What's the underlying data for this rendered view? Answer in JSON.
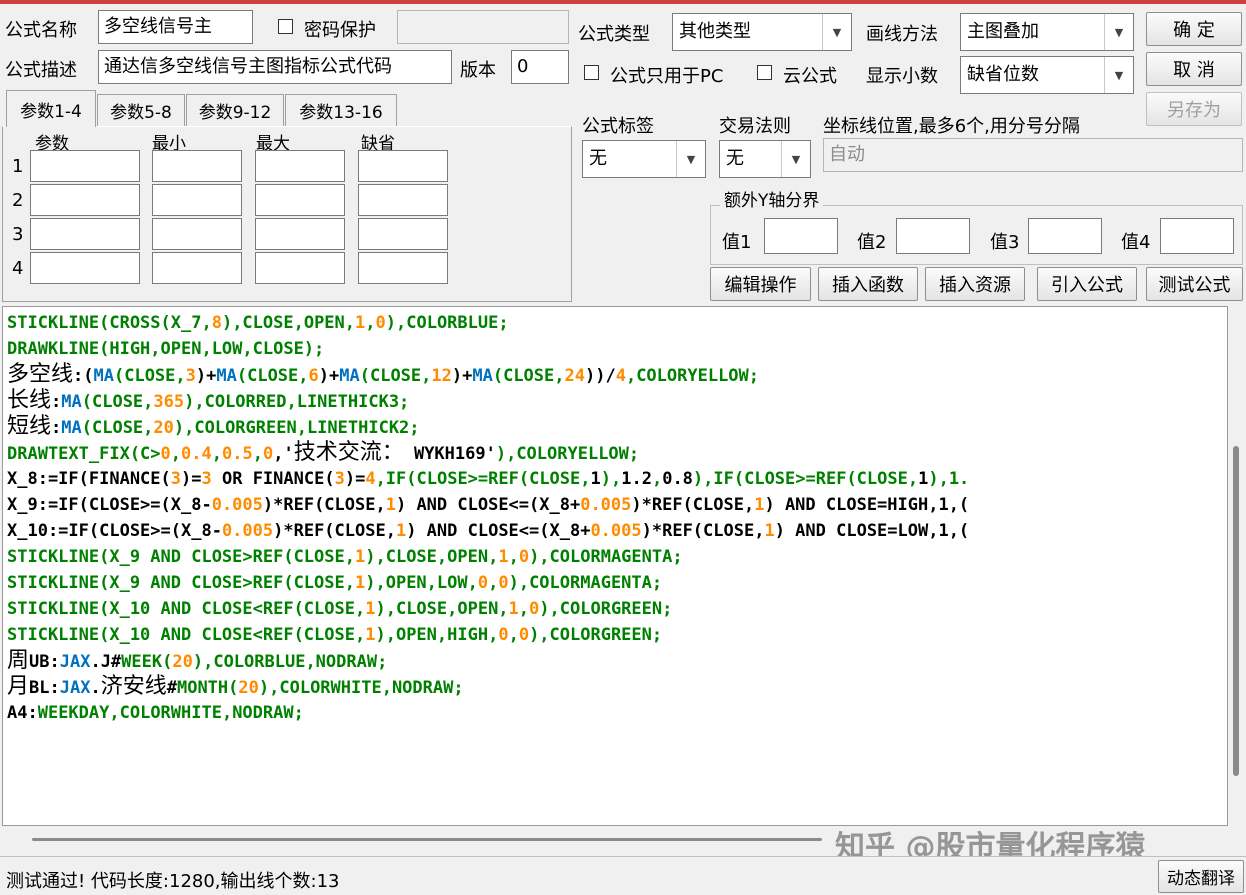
{
  "colors": {
    "green": "#008000",
    "blue": "#0070c0",
    "orange": "#ff8c00",
    "black": "#000000",
    "accent_top": "#d04040"
  },
  "form": {
    "name_label": "公式名称",
    "name_value": "多空线信号主",
    "pwd_label": "密码保护",
    "desc_label": "公式描述",
    "desc_value": "通达信多空线信号主图指标公式代码",
    "version_label": "版本",
    "version_value": "0",
    "type_label": "公式类型",
    "type_value": "其他类型",
    "draw_label": "画线方法",
    "draw_value": "主图叠加",
    "pc_only_label": "公式只用于PC",
    "cloud_label": "云公式",
    "decimals_label": "显示小数",
    "decimals_value": "缺省位数",
    "tag_label": "公式标签",
    "tag_value": "无",
    "rule_label": "交易法则",
    "rule_value": "无",
    "axis_label": "坐标线位置,最多6个,用分号分隔",
    "axis_value": "自动",
    "extra_y_label": "额外Y轴分界",
    "extra_values": [
      "值1",
      "值2",
      "值3",
      "值4"
    ]
  },
  "buttons": {
    "ok": "确  定",
    "cancel": "取  消",
    "save_as": "另存为",
    "edit": "编辑操作",
    "insert_func": "插入函数",
    "insert_res": "插入资源",
    "import": "引入公式",
    "test": "测试公式",
    "dyn_translate": "动态翻译"
  },
  "tabs": [
    "参数1-4",
    "参数5-8",
    "参数9-12",
    "参数13-16"
  ],
  "param_headers": [
    "参数",
    "最小",
    "最大",
    "缺省"
  ],
  "param_rows": [
    "1",
    "2",
    "3",
    "4"
  ],
  "code_lines": [
    [
      [
        "STICKLINE(CROSS(X_7,",
        "green"
      ],
      [
        "8",
        "orange"
      ],
      [
        "),CLOSE,OPEN,",
        "green"
      ],
      [
        "1",
        "orange"
      ],
      [
        ",",
        "green"
      ],
      [
        "0",
        "orange"
      ],
      [
        "),COLORBLUE;",
        "green"
      ]
    ],
    [
      [
        "DRAWKLINE(HIGH,OPEN,LOW,CLOSE);",
        "green"
      ]
    ],
    [
      [
        "多空线",
        "cjk"
      ],
      [
        ":(",
        "black"
      ],
      [
        "MA",
        "blue"
      ],
      [
        "(CLOSE,",
        "green"
      ],
      [
        "3",
        "orange"
      ],
      [
        ")+",
        "black"
      ],
      [
        "MA",
        "blue"
      ],
      [
        "(CLOSE,",
        "green"
      ],
      [
        "6",
        "orange"
      ],
      [
        ")+",
        "black"
      ],
      [
        "MA",
        "blue"
      ],
      [
        "(CLOSE,",
        "green"
      ],
      [
        "12",
        "orange"
      ],
      [
        ")+",
        "black"
      ],
      [
        "MA",
        "blue"
      ],
      [
        "(CLOSE,",
        "green"
      ],
      [
        "24",
        "orange"
      ],
      [
        "))/",
        "black"
      ],
      [
        "4",
        "orange"
      ],
      [
        ",COLORYELLOW;",
        "green"
      ]
    ],
    [
      [
        "长线",
        "cjk"
      ],
      [
        ":",
        "black"
      ],
      [
        "MA",
        "blue"
      ],
      [
        "(CLOSE,",
        "green"
      ],
      [
        "365",
        "orange"
      ],
      [
        "),COLORRED,LINETHICK3;",
        "green"
      ]
    ],
    [
      [
        "短线",
        "cjk"
      ],
      [
        ":",
        "black"
      ],
      [
        "MA",
        "blue"
      ],
      [
        "(CLOSE,",
        "green"
      ],
      [
        "20",
        "orange"
      ],
      [
        "),COLORGREEN,LINETHICK2;",
        "green"
      ]
    ],
    [
      [
        "DRAWTEXT_FIX(C>",
        "green"
      ],
      [
        "0",
        "orange"
      ],
      [
        ",",
        "green"
      ],
      [
        "0.4",
        "orange"
      ],
      [
        ",",
        "green"
      ],
      [
        "0.5",
        "orange"
      ],
      [
        ",",
        "green"
      ],
      [
        "0",
        "orange"
      ],
      [
        ",'",
        "black"
      ],
      [
        "技术交流：",
        "cjk"
      ],
      [
        " WYKH169'",
        "black"
      ],
      [
        "),COLORYELLOW;",
        "green"
      ]
    ],
    [
      [
        "X_8:=IF(FINANCE(",
        "black"
      ],
      [
        "3",
        "orange"
      ],
      [
        ")=",
        "black"
      ],
      [
        "3",
        "orange"
      ],
      [
        " OR FINANCE(",
        "black"
      ],
      [
        "3",
        "orange"
      ],
      [
        ")=",
        "black"
      ],
      [
        "4",
        "orange"
      ],
      [
        ",IF(CLOSE>=REF(CLOSE,",
        "green"
      ],
      [
        "1",
        "black"
      ],
      [
        "),",
        "green"
      ],
      [
        "1.2",
        "black"
      ],
      [
        ",",
        "green"
      ],
      [
        "0.8",
        "black"
      ],
      [
        "),IF(CLOSE>=REF(CLOSE,",
        "green"
      ],
      [
        "1",
        "black"
      ],
      [
        "),1.",
        "green"
      ]
    ],
    [
      [
        "X_9:=IF(CLOSE>=(X_8-",
        "black"
      ],
      [
        "0.005",
        "orange"
      ],
      [
        ")*REF(CLOSE,",
        "black"
      ],
      [
        "1",
        "orange"
      ],
      [
        ") AND CLOSE<=(X_8+",
        "black"
      ],
      [
        "0.005",
        "orange"
      ],
      [
        ")*REF(CLOSE,",
        "black"
      ],
      [
        "1",
        "orange"
      ],
      [
        ") AND CLOSE=HIGH,1,(",
        "black"
      ]
    ],
    [
      [
        "X_10:=IF(CLOSE>=(X_8-",
        "black"
      ],
      [
        "0.005",
        "orange"
      ],
      [
        ")*REF(CLOSE,",
        "black"
      ],
      [
        "1",
        "orange"
      ],
      [
        ") AND CLOSE<=(X_8+",
        "black"
      ],
      [
        "0.005",
        "orange"
      ],
      [
        ")*REF(CLOSE,",
        "black"
      ],
      [
        "1",
        "orange"
      ],
      [
        ") AND CLOSE=LOW,1,(",
        "black"
      ]
    ],
    [
      [
        "STICKLINE(X_9 AND CLOSE>REF(CLOSE,",
        "green"
      ],
      [
        "1",
        "orange"
      ],
      [
        "),CLOSE,OPEN,",
        "green"
      ],
      [
        "1",
        "orange"
      ],
      [
        ",",
        "green"
      ],
      [
        "0",
        "orange"
      ],
      [
        "),COLORMAGENTA;",
        "green"
      ]
    ],
    [
      [
        "STICKLINE(X_9 AND CLOSE>REF(CLOSE,",
        "green"
      ],
      [
        "1",
        "orange"
      ],
      [
        "),OPEN,LOW,",
        "green"
      ],
      [
        "0",
        "orange"
      ],
      [
        ",",
        "green"
      ],
      [
        "0",
        "orange"
      ],
      [
        "),COLORMAGENTA;",
        "green"
      ]
    ],
    [
      [
        "STICKLINE(X_10 AND CLOSE<REF(CLOSE,",
        "green"
      ],
      [
        "1",
        "orange"
      ],
      [
        "),CLOSE,OPEN,",
        "green"
      ],
      [
        "1",
        "orange"
      ],
      [
        ",",
        "green"
      ],
      [
        "0",
        "orange"
      ],
      [
        "),COLORGREEN;",
        "green"
      ]
    ],
    [
      [
        "STICKLINE(X_10 AND CLOSE<REF(CLOSE,",
        "green"
      ],
      [
        "1",
        "orange"
      ],
      [
        "),OPEN,HIGH,",
        "green"
      ],
      [
        "0",
        "orange"
      ],
      [
        ",",
        "green"
      ],
      [
        "0",
        "orange"
      ],
      [
        "),COLORGREEN;",
        "green"
      ]
    ],
    [
      [
        "周",
        "cjk"
      ],
      [
        "UB:",
        "black"
      ],
      [
        "JAX",
        "blue"
      ],
      [
        ".J#",
        "black"
      ],
      [
        "WEEK",
        "green"
      ],
      [
        "(",
        "green"
      ],
      [
        "20",
        "orange"
      ],
      [
        "),COLORBLUE,NODRAW;",
        "green"
      ]
    ],
    [
      [
        "月",
        "cjk"
      ],
      [
        "BL:",
        "black"
      ],
      [
        "JAX",
        "blue"
      ],
      [
        ".",
        "black"
      ],
      [
        "济安线",
        "cjk"
      ],
      [
        "#",
        "black"
      ],
      [
        "MONTH",
        "green"
      ],
      [
        "(",
        "green"
      ],
      [
        "20",
        "orange"
      ],
      [
        "),COLORWHITE,NODRAW;",
        "green"
      ]
    ],
    [
      [
        "A4:",
        "black"
      ],
      [
        "WEEKDAY",
        "green"
      ],
      [
        ",COLORWHITE,NODRAW;",
        "green"
      ]
    ]
  ],
  "watermark": "知乎 @股市量化程序猿",
  "status_text": "测试通过! 代码长度:1280,输出线个数:13"
}
